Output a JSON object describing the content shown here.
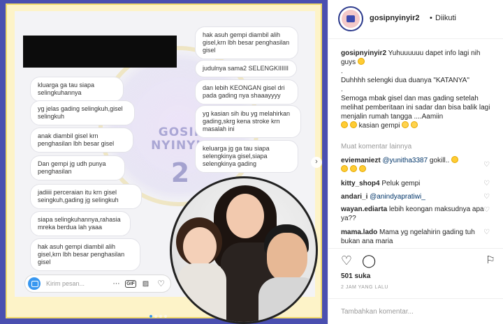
{
  "colors": {
    "media_bg": "#4a4fb0",
    "frame": "#fdf3c8",
    "link": "#003569",
    "accent": "#3897f0"
  },
  "media": {
    "watermark_text": [
      "GOSIP",
      "NYINYIR"
    ],
    "watermark_number": "2",
    "left_messages": [
      "kluarga ga tau siapa\nselingkuhannya",
      "yg jelas gading selingkuh,gisel\nselingkuh",
      "anak diambil gisel krn\npenghasilan lbh besar gisel",
      "Dan gempi jg udh punya\npenghasilan",
      "jadiiii perceraian itu krn gisel\nseingkuh,gading jg selingkuh",
      "siapa selingkuhannya,rahasia\nmreka berdua lah yaaa",
      "hak asuh gempi diambil alih\ngisel,krn lbh besar penghasilan\ngisel"
    ],
    "right_messages": [
      "hak asuh gempi diambil alih\ngisel,krn lbh besar penghasilan\ngisel",
      "judulnya sama2 SELENGKIIIIII",
      "dan lebih KEONGAN gisel dri\npada gading nya shaaayyyy",
      "yg kasian sih ibu yg melahirkan\ngading,skrg kena stroke krn\nmasalah ini",
      "keluarga jg ga tau siapa\nselengkinya gisel,siapa\nselengkinya gading"
    ],
    "message_placeholder": "Kirim pesan...",
    "gif_label": "GIF",
    "slide_count": 4,
    "active_slide": 1
  },
  "post": {
    "username": "gosipnyinyir2",
    "separator": "•",
    "follow_status": "Diikuti",
    "caption_lines": [
      "Yuhuuuuuu dapet info lagi nih guys",
      ".",
      "Duhhhh selengki dua duanya \"KATANYA\"",
      ".",
      "Semoga mbak gisel dan mas gading setelah melihat pemberitaan ini sadar dan bisa balik lagi menjalin rumah tangga ....Aamiin",
      "kasian gempi"
    ],
    "more_comments": "Muat komentar lainnya",
    "comments": [
      {
        "user": "eviemaniezt",
        "mention": "@yunitha3387",
        "text": "gokill.."
      },
      {
        "user": "kitty_shop4",
        "mention": "",
        "text": "Peluk gempi"
      },
      {
        "user": "andari_i",
        "mention": "@anindyapratiwi_",
        "text": ""
      },
      {
        "user": "wayan.ediarta",
        "mention": "",
        "text": "lebih keongan maksudnya apa ya??"
      },
      {
        "user": "mama.lado",
        "mention": "",
        "text": "Mama yg ngelahirin gading tuh bukan ana maria"
      }
    ],
    "likes": "501 suka",
    "timestamp": "2 JAM YANG LALU",
    "add_comment_placeholder": "Tambahkan komentar..."
  }
}
